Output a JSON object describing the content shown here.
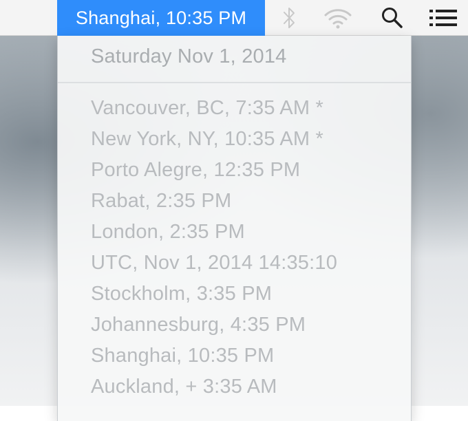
{
  "menubar": {
    "clock_label": "Shanghai, 10:35 PM",
    "icons": [
      "bluetooth-icon",
      "wifi-icon",
      "search-icon",
      "list-icon"
    ]
  },
  "dropdown": {
    "date_header": "Saturday Nov 1, 2014",
    "zones": [
      {
        "label": "Vancouver, BC, 7:35 AM *"
      },
      {
        "label": "New York, NY, 10:35 AM *"
      },
      {
        "label": "Porto Alegre, 12:35 PM"
      },
      {
        "label": "Rabat, 2:35 PM"
      },
      {
        "label": "London, 2:35 PM"
      },
      {
        "label": "UTC, Nov 1, 2014 14:35:10"
      },
      {
        "label": "Stockholm, 3:35 PM"
      },
      {
        "label": "Johannesburg, 4:35 PM"
      },
      {
        "label": "Shanghai, 10:35 PM"
      },
      {
        "label": "Auckland, + 3:35 AM"
      }
    ]
  },
  "colors": {
    "accent": "#2f8dfb",
    "menu_text_disabled": "#b8bbbe"
  }
}
